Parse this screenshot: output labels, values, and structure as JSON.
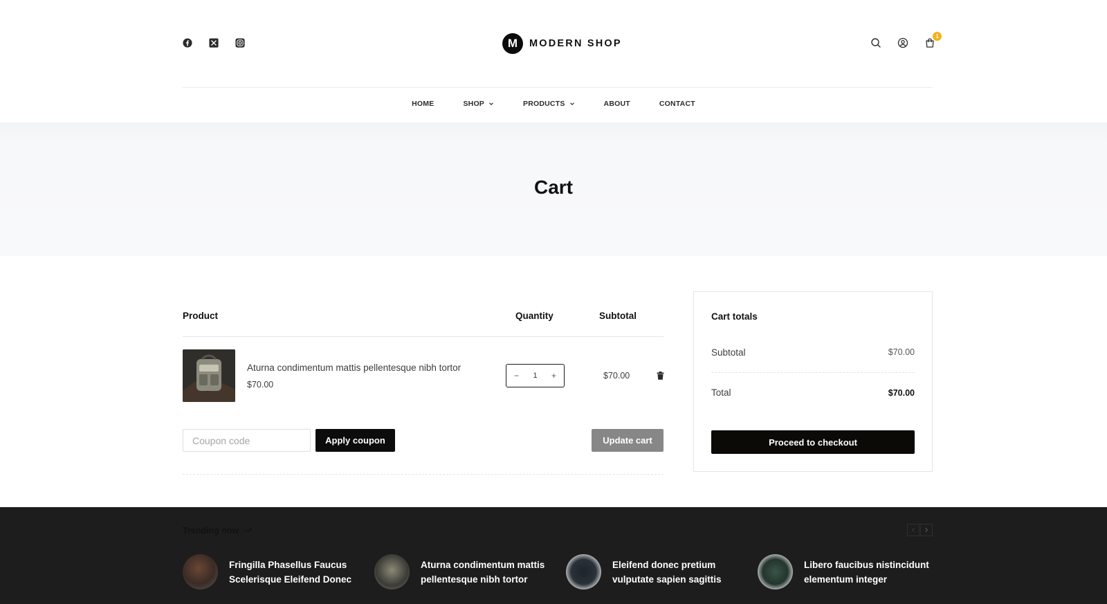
{
  "header": {
    "logo_letter": "M",
    "logo_text": "MODERN SHOP",
    "social_icons": [
      "facebook-icon",
      "x-icon",
      "instagram-icon"
    ],
    "cart_count": "1"
  },
  "nav": {
    "items": [
      {
        "label": "HOME"
      },
      {
        "label": "SHOP"
      },
      {
        "label": "PRODUCTS"
      },
      {
        "label": "ABOUT"
      },
      {
        "label": "CONTACT"
      }
    ]
  },
  "hero": {
    "title": "Cart"
  },
  "cart": {
    "columns": {
      "product": "Product",
      "quantity": "Quantity",
      "subtotal": "Subtotal"
    },
    "items": [
      {
        "name": "Aturna condimentum mattis pellentesque nibh tortor",
        "price": "$70.00",
        "quantity": "1",
        "subtotal": "$70.00"
      }
    ],
    "coupon_placeholder": "Coupon code",
    "apply_label": "Apply coupon",
    "update_label": "Update cart"
  },
  "totals": {
    "title": "Cart totals",
    "subtotal_label": "Subtotal",
    "subtotal_value": "$70.00",
    "total_label": "Total",
    "total_value": "$70.00",
    "checkout_label": "Proceed to checkout"
  },
  "trending": {
    "title": "Trending now",
    "items": [
      {
        "name": "Fringilla Phasellus Faucus Scelerisque Eleifend Donec"
      },
      {
        "name": "Aturna condimentum mattis pellentesque nibh tortor"
      },
      {
        "name": "Eleifend donec pretium vulputate sapien sagittis"
      },
      {
        "name": "Libero faucibus nistincidunt elementum integer"
      }
    ]
  },
  "colors": {
    "accent_badge": "#f4b21b",
    "primary_button": "#0c0c0c",
    "disabled_button": "#878787",
    "footer_bg": "#1d1d1d",
    "hero_bg": "#f8f9fa"
  }
}
